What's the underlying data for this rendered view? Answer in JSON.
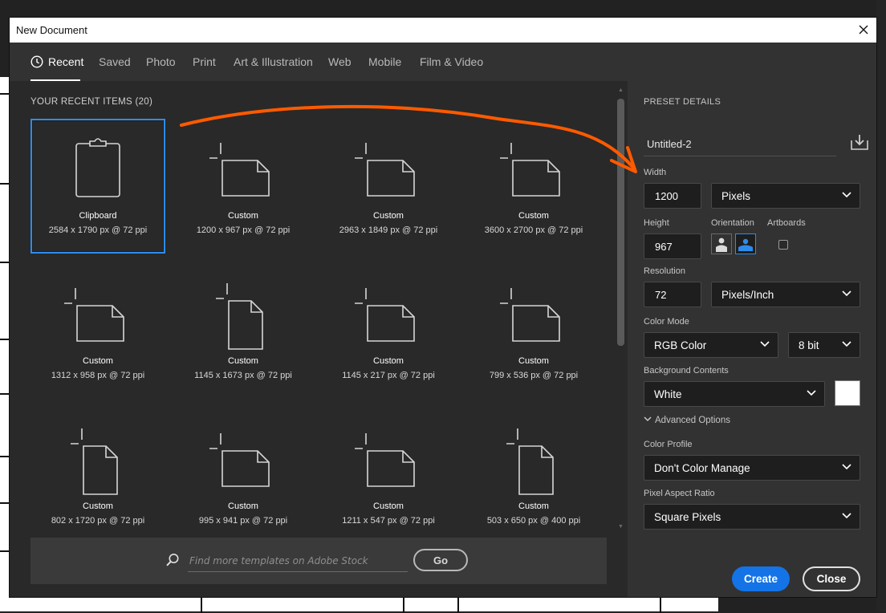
{
  "window": {
    "title": "New Document"
  },
  "tabs": [
    {
      "label": "Recent",
      "active": true
    },
    {
      "label": "Saved"
    },
    {
      "label": "Photo"
    },
    {
      "label": "Print"
    },
    {
      "label": "Art & Illustration"
    },
    {
      "label": "Web"
    },
    {
      "label": "Mobile"
    },
    {
      "label": "Film & Video"
    }
  ],
  "recent": {
    "heading": "YOUR RECENT ITEMS",
    "count": "(20)",
    "items": [
      {
        "name": "Clipboard",
        "dims": "2584 x 1790 px @ 72 ppi",
        "icon": "clipboard-icon",
        "selected": true
      },
      {
        "name": "Custom",
        "dims": "1200 x 967 px @ 72 ppi",
        "icon": "landscape-doc-icon"
      },
      {
        "name": "Custom",
        "dims": "2963 x 1849 px @ 72 ppi",
        "icon": "landscape-doc-icon"
      },
      {
        "name": "Custom",
        "dims": "3600 x 2700 px @ 72 ppi",
        "icon": "landscape-doc-icon"
      },
      {
        "name": "Custom",
        "dims": "1312 x 958 px @ 72 ppi",
        "icon": "landscape-doc-icon"
      },
      {
        "name": "Custom",
        "dims": "1145 x 1673 px @ 72 ppi",
        "icon": "portrait-doc-icon"
      },
      {
        "name": "Custom",
        "dims": "1145 x 217 px @ 72 ppi",
        "icon": "landscape-doc-icon"
      },
      {
        "name": "Custom",
        "dims": "799 x 536 px @ 72 ppi",
        "icon": "landscape-doc-icon"
      },
      {
        "name": "Custom",
        "dims": "802 x 1720 px @ 72 ppi",
        "icon": "portrait-doc-icon"
      },
      {
        "name": "Custom",
        "dims": "995 x 941 px @ 72 ppi",
        "icon": "landscape-doc-icon"
      },
      {
        "name": "Custom",
        "dims": "1211 x 547 px @ 72 ppi",
        "icon": "landscape-doc-icon"
      },
      {
        "name": "Custom",
        "dims": "503 x 650 px @ 400 ppi",
        "icon": "portrait-doc-icon"
      }
    ]
  },
  "search": {
    "placeholder": "Find more templates on Adobe Stock",
    "go_label": "Go"
  },
  "preset": {
    "heading": "PRESET DETAILS",
    "doc_name": "Untitled-2",
    "width_label": "Width",
    "width_value": "1200",
    "width_unit": "Pixels",
    "height_label": "Height",
    "height_value": "967",
    "orientation_label": "Orientation",
    "artboards_label": "Artboards",
    "resolution_label": "Resolution",
    "resolution_value": "72",
    "resolution_unit": "Pixels/Inch",
    "color_mode_label": "Color Mode",
    "color_mode": "RGB Color",
    "bit_depth": "8 bit",
    "bg_label": "Background Contents",
    "bg_value": "White",
    "bg_swatch": "#ffffff",
    "advanced_label": "Advanced Options",
    "profile_label": "Color Profile",
    "profile_value": "Don't Color Manage",
    "aspect_label": "Pixel Aspect Ratio",
    "aspect_value": "Square Pixels"
  },
  "buttons": {
    "create": "Create",
    "close": "Close"
  },
  "colors": {
    "accent": "#1473e6",
    "selection": "#2d8ceb",
    "annotation_arrow": "#ff5a00"
  }
}
